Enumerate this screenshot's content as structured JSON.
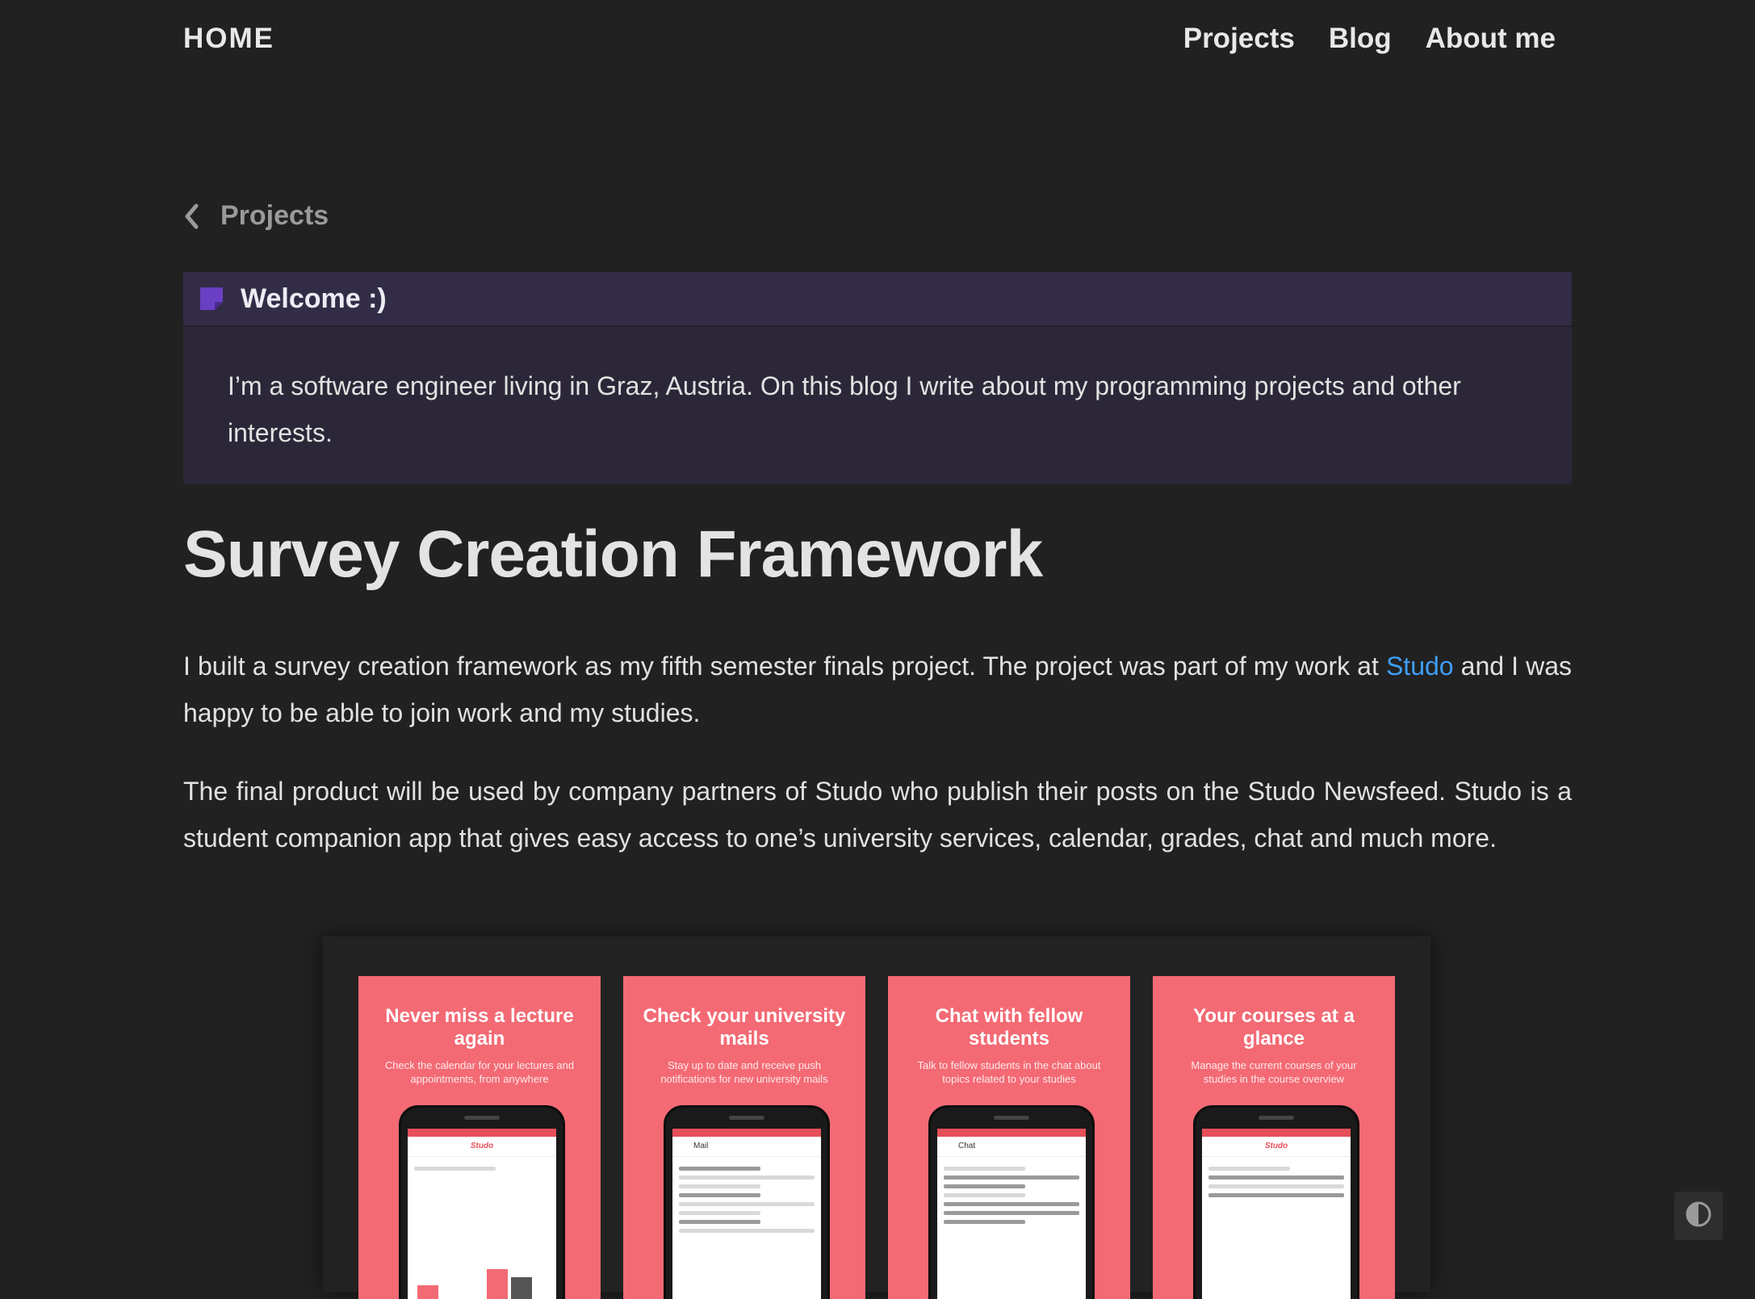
{
  "header": {
    "home": "HOME",
    "nav": [
      "Projects",
      "Blog",
      "About me"
    ]
  },
  "back_link": {
    "label": "Projects"
  },
  "welcome": {
    "title": "Welcome :)",
    "body": "I’m a software engineer living in Graz, Austria. On this blog I write about my programming projects and other interests."
  },
  "article": {
    "title": "Survey Creation Framework",
    "p1_before": "I built a survey creation framework as my fifth semester finals project. The project was part of my work at ",
    "p1_link": "Studo",
    "p1_after": " and I was happy to be able to join work and my studies.",
    "p2": "The final product will be used by company partners of Studo who publish their posts on the Studo Newsfeed. Studo is a student companion app that gives easy access to one’s university services, calendar, grades, chat and much more."
  },
  "screenshots": [
    {
      "heading": "Never miss a lecture again",
      "sub": "Check the calendar for your lectures and appointments, from anywhere",
      "screen": "Studo"
    },
    {
      "heading": "Check your university mails",
      "sub": "Stay up to date and receive push notifications for new university mails",
      "screen": "Mail"
    },
    {
      "heading": "Chat with fellow students",
      "sub": "Talk to fellow students in the chat about topics related to your studies",
      "screen": "Chat"
    },
    {
      "heading": "Your courses at a glance",
      "sub": "Manage the current courses of your studies in the course overview",
      "screen": "Studo"
    }
  ],
  "colors": {
    "background": "#212121",
    "card": "#2c2738",
    "card_header": "#332c46",
    "accent_link": "#3d9ef5",
    "note_icon": "#6a3fc4",
    "studo_red": "#f36a74"
  },
  "icons": {
    "back": "chevron-left-icon",
    "note": "note-icon",
    "theme": "contrast-icon"
  }
}
